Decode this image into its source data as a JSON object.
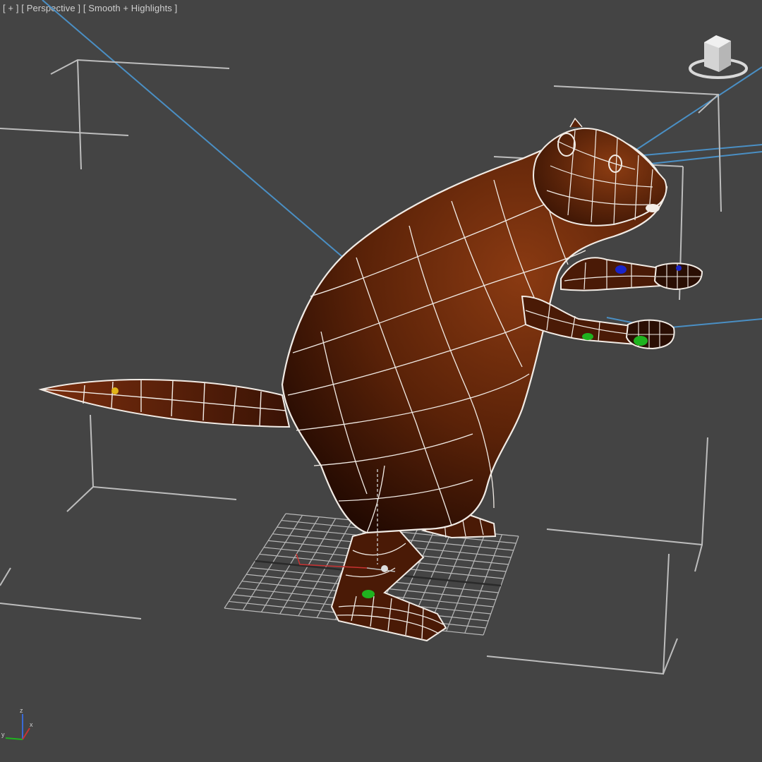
{
  "viewport": {
    "label_menu": "[ + ]",
    "label_view": "[ Perspective ]",
    "label_shading": "[ Smooth + Highlights ]"
  },
  "viewcube": {
    "face_label": "",
    "icon": "viewcube-icon"
  },
  "axis_tripod": {
    "x": "x",
    "y": "y",
    "z": "z"
  },
  "colors": {
    "background": "#444444",
    "mesh_fill": "#5a2208",
    "mesh_fill_light": "#8a3a12",
    "wire": "#f2ece6",
    "bone_box": "#bdbdbd",
    "bone_link": "#4a8fc4",
    "grid": "#bdbdbd",
    "marker_green": "#1fb31f",
    "marker_blue": "#1a24c8",
    "marker_yellow": "#e0b419"
  }
}
